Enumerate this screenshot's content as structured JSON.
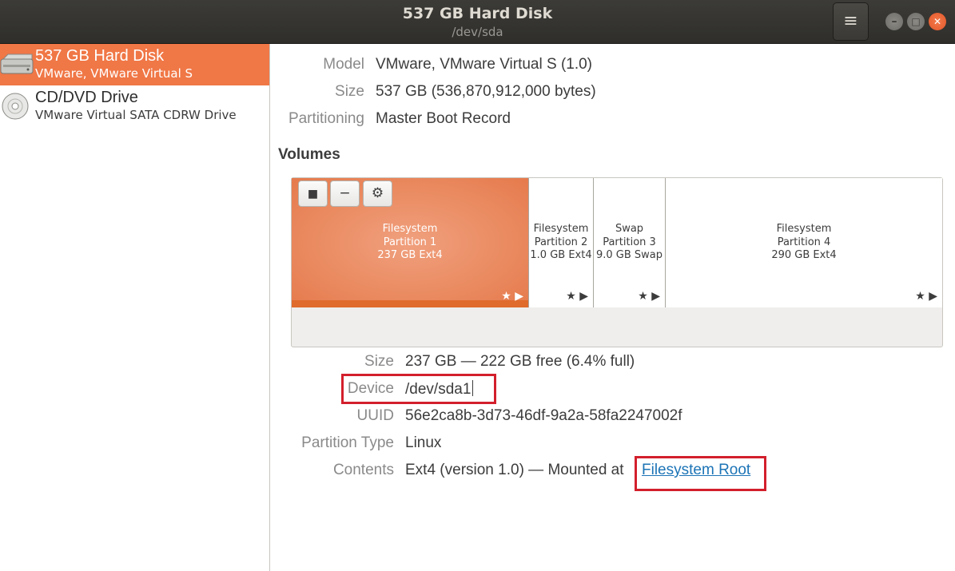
{
  "window": {
    "title": "537 GB Hard Disk",
    "subtitle": "/dev/sda",
    "menu_icon": "≡",
    "minimize_icon": "–",
    "maximize_icon": "□",
    "close_icon": "✕"
  },
  "sidebar": {
    "items": [
      {
        "name": "537 GB Hard Disk",
        "description": "VMware, VMware Virtual S",
        "icon": "hard-disk-icon",
        "selected": true
      },
      {
        "name": "CD/DVD Drive",
        "description": "VMware Virtual SATA CDRW Drive",
        "icon": "optical-drive-icon",
        "selected": false
      }
    ]
  },
  "disk": {
    "model_label": "Model",
    "model_value": "VMware, VMware Virtual S (1.0)",
    "size_label": "Size",
    "size_value": "537 GB (536,870,912,000 bytes)",
    "partitioning_label": "Partitioning",
    "partitioning_value": "Master Boot Record"
  },
  "volumes": {
    "title": "Volumes",
    "partitions": [
      {
        "line1": "Filesystem",
        "line2": "Partition 1",
        "line3": "237 GB Ext4",
        "selected": true
      },
      {
        "line1": "Filesystem",
        "line2": "Partition 2",
        "line3": "1.0 GB Ext4",
        "selected": false
      },
      {
        "line1": "Swap",
        "line2": "Partition 3",
        "line3": "9.0 GB Swap",
        "selected": false
      },
      {
        "line1": "Filesystem",
        "line2": "Partition 4",
        "line3": "290 GB Ext4",
        "selected": false
      }
    ],
    "partition_marks": "★ ▶",
    "toolbar": {
      "stop_icon": "■",
      "remove_icon": "−",
      "settings_icon": "⚙"
    }
  },
  "selected_volume": {
    "size_label": "Size",
    "size_value": "237 GB — 222 GB free (6.4% full)",
    "device_label": "Device",
    "device_value": "/dev/sda1",
    "uuid_label": "UUID",
    "uuid_value": "56e2ca8b-3d73-46df-9a2a-58fa2247002f",
    "partition_type_label": "Partition Type",
    "partition_type_value": "Linux",
    "contents_label": "Contents",
    "contents_prefix": "Ext4 (version 1.0) — Mounted at",
    "contents_link": "Filesystem Root"
  },
  "colors": {
    "accent": "#f07746",
    "highlight_box": "#d31f2c",
    "link": "#1c74b6"
  }
}
